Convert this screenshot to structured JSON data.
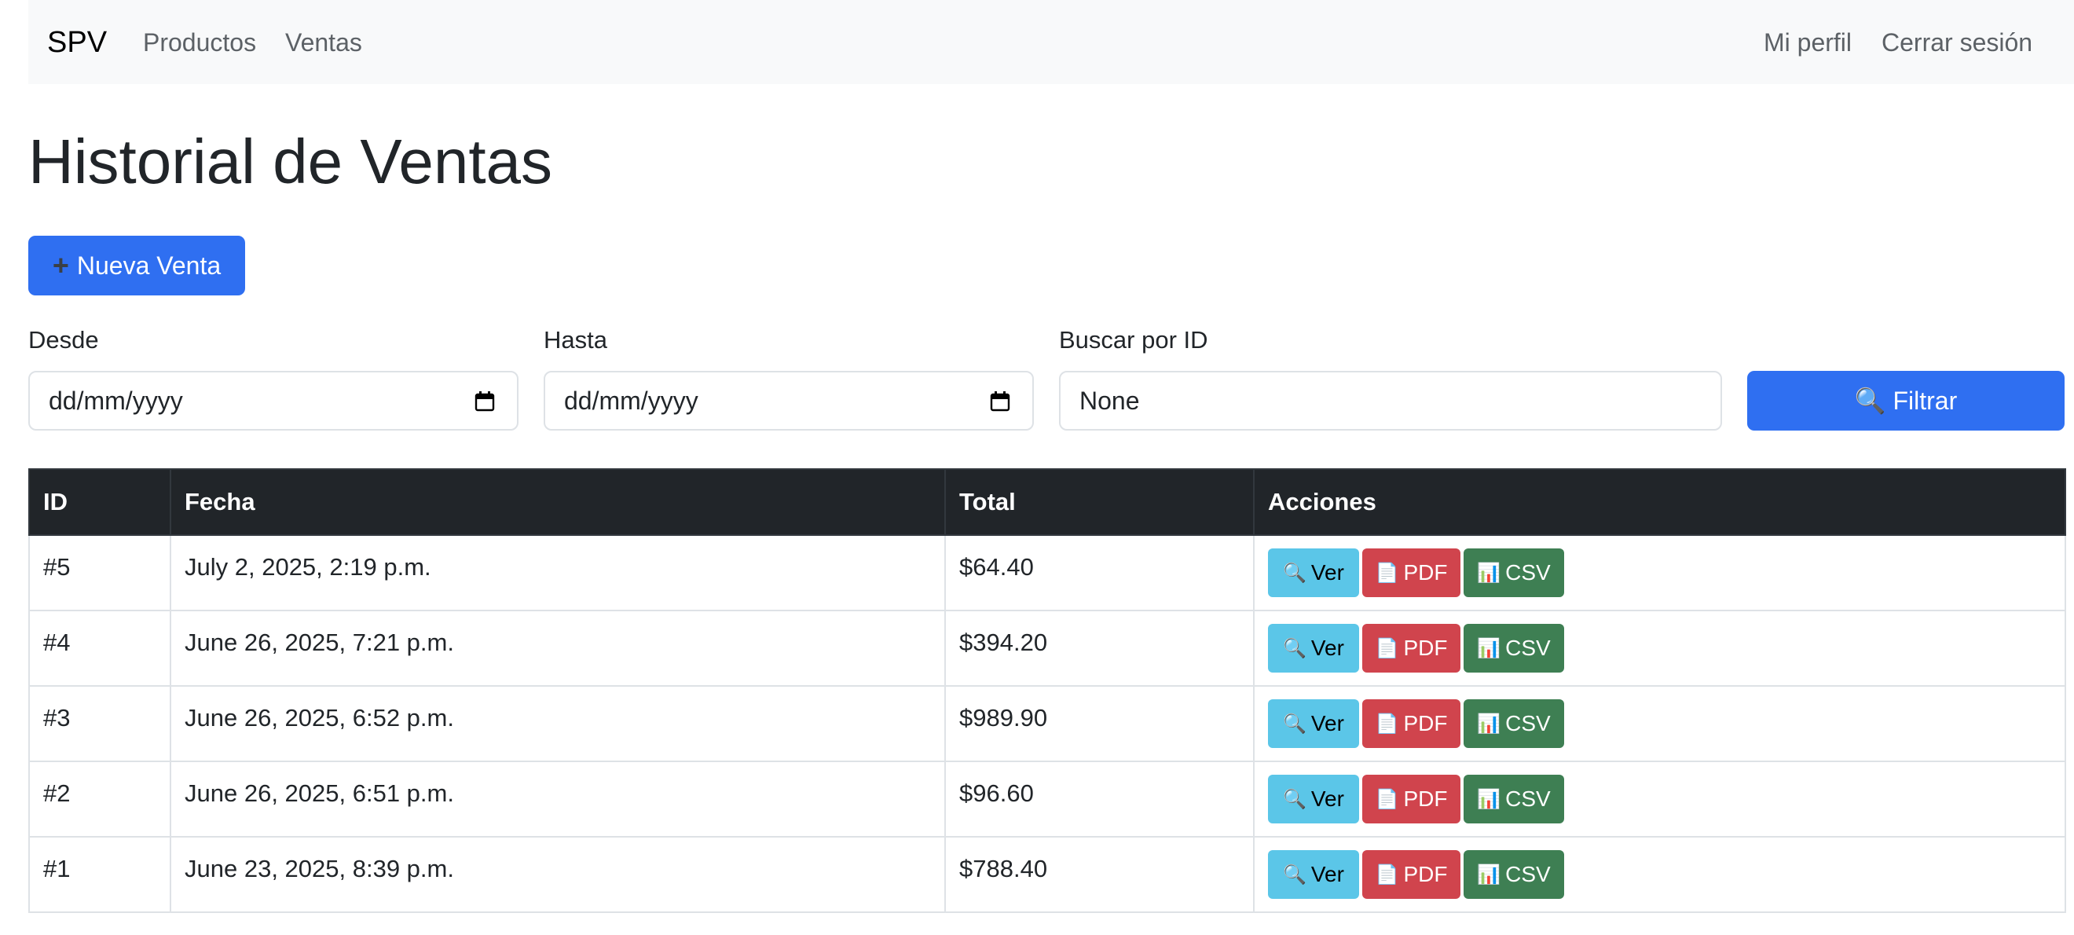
{
  "navbar": {
    "brand": "SPV",
    "left_links": [
      "Productos",
      "Ventas"
    ],
    "right_links": [
      "Mi perfil",
      "Cerrar sesión"
    ]
  },
  "page": {
    "title": "Historial de Ventas"
  },
  "actions": {
    "new_sale_icon": "+",
    "new_sale_label": "Nueva Venta"
  },
  "filters": {
    "desde_label": "Desde",
    "desde_value": "dd/mm/yyyy",
    "hasta_label": "Hasta",
    "hasta_value": "dd/mm/yyyy",
    "buscar_label": "Buscar por ID",
    "buscar_value": "None",
    "filter_button": "🔍 Filtrar"
  },
  "table": {
    "headers": [
      "ID",
      "Fecha",
      "Total",
      "Acciones"
    ],
    "rows": [
      {
        "id": "#5",
        "fecha": "July 2, 2025, 2:19 p.m.",
        "total": "$64.40"
      },
      {
        "id": "#4",
        "fecha": "June 26, 2025, 7:21 p.m.",
        "total": "$394.20"
      },
      {
        "id": "#3",
        "fecha": "June 26, 2025, 6:52 p.m.",
        "total": "$989.90"
      },
      {
        "id": "#2",
        "fecha": "June 26, 2025, 6:51 p.m.",
        "total": "$96.60"
      },
      {
        "id": "#1",
        "fecha": "June 23, 2025, 8:39 p.m.",
        "total": "$788.40"
      }
    ],
    "row_actions": {
      "ver_icon": "🔍",
      "ver": "Ver",
      "pdf_icon": "📄",
      "pdf": "PDF",
      "csv_icon": "📊",
      "csv": "CSV"
    }
  },
  "colors": {
    "primary": "#2f6ff1",
    "info": "#5bc6e8",
    "danger": "#d0444d",
    "success": "#3e7f53",
    "table_header": "#212529",
    "navbar_bg": "#f8f9fa"
  },
  "icons": {
    "calendar": "calendar-icon",
    "search": "search-icon",
    "plus": "plus-icon",
    "document": "document-icon",
    "chart": "chart-icon"
  }
}
